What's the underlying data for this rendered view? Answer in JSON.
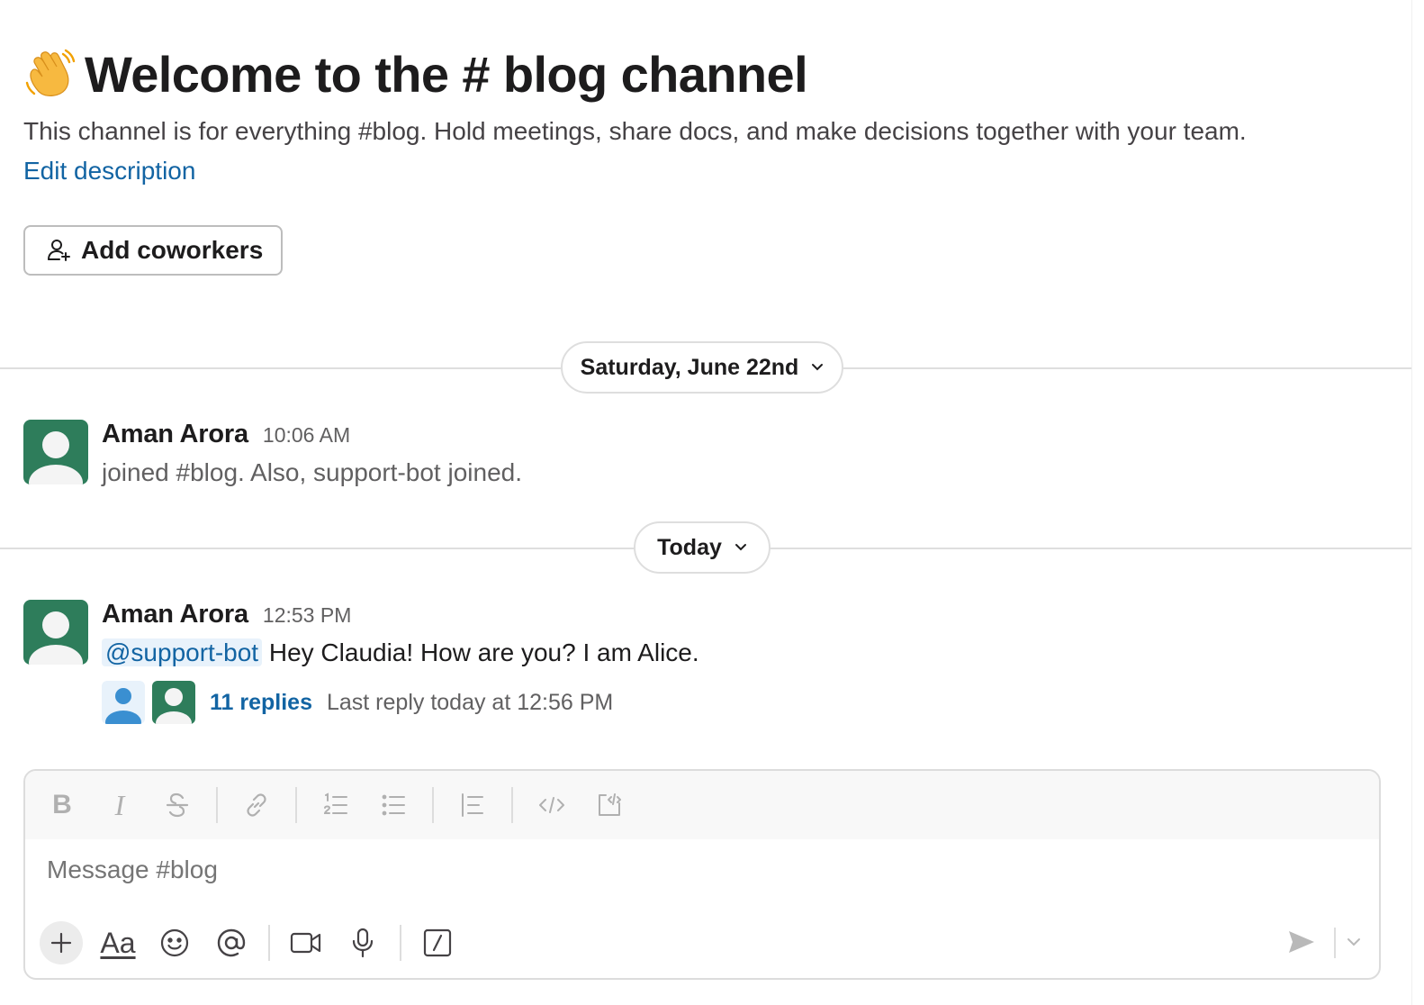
{
  "intro": {
    "emoji": "👋",
    "title": "Welcome to the # blog channel",
    "description": "This channel is for everything #blog. Hold meetings, share docs, and make decisions together with your team.",
    "edit_link": "Edit description",
    "add_button": "Add coworkers"
  },
  "dividers": [
    {
      "label": "Saturday, June 22nd"
    },
    {
      "label": "Today"
    }
  ],
  "messages": [
    {
      "author": "Aman Arora",
      "time": "10:06 AM",
      "text": "joined #blog. Also, support-bot joined."
    },
    {
      "author": "Aman Arora",
      "time": "12:53 PM",
      "mention": "@support-bot",
      "text": "Hey Claudia! How are you? I am Alice.",
      "thread": {
        "replies": "11 replies",
        "last_reply": "Last reply today at 12:56 PM"
      }
    }
  ],
  "composer": {
    "placeholder": "Message #blog",
    "format_buttons": [
      "bold-icon",
      "italic-icon",
      "strikethrough-icon",
      "link-icon",
      "ordered-list-icon",
      "bulleted-list-icon",
      "blockquote-icon",
      "code-icon",
      "code-block-icon"
    ],
    "bold_glyph": "B",
    "italic_glyph": "I",
    "format_text_glyph": "Aa"
  },
  "colors": {
    "avatar_green": "#2e7d5b",
    "link_blue": "#1264a3",
    "mention_bg": "#e8f2fb"
  }
}
